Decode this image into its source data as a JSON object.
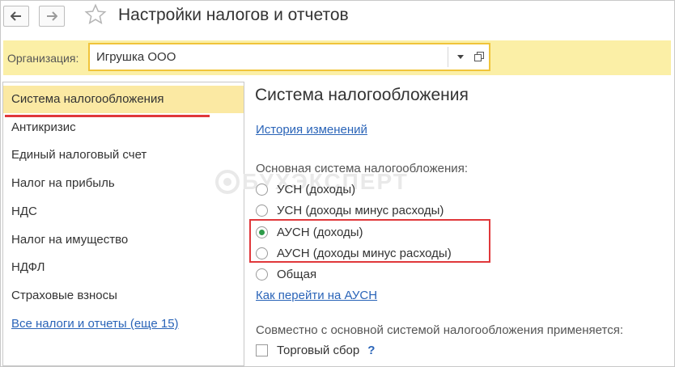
{
  "window": {
    "title": "Настройки налогов и отчетов"
  },
  "organization": {
    "label": "Организация:",
    "value": "Игрушка ООО"
  },
  "sidebar": {
    "items": [
      {
        "label": "Система налогообложения",
        "active": true
      },
      {
        "label": "Антикризис"
      },
      {
        "label": "Единый налоговый счет"
      },
      {
        "label": "Налог на прибыль"
      },
      {
        "label": "НДС"
      },
      {
        "label": "Налог на имущество"
      },
      {
        "label": "НДФЛ"
      },
      {
        "label": "Страховые взносы"
      }
    ],
    "all_link": "Все налоги и отчеты (еще 15)"
  },
  "main": {
    "title": "Система налогообложения",
    "history_link": "История изменений",
    "tax_system_label": "Основная система налогообложения:",
    "options": [
      {
        "label": "УСН (доходы)",
        "checked": false
      },
      {
        "label": "УСН (доходы минус расходы)",
        "checked": false
      },
      {
        "label": "АУСН (доходы)",
        "checked": true
      },
      {
        "label": "АУСН (доходы минус расходы)",
        "checked": false
      },
      {
        "label": "Общая",
        "checked": false
      }
    ],
    "ausn_link": "Как перейти на АУСН",
    "combined_label": "Совместно с основной системой налогообложения применяется:",
    "trade_fee_label": "Торговый сбор",
    "help_mark": "?"
  },
  "watermark": "БУХЭКСПЕРТ",
  "colors": {
    "accent_yellow": "#fbefa6",
    "active_item": "#fbe9a3",
    "highlight_red": "#e0383b",
    "link_blue": "#2a64b8",
    "radio_green": "#2e9b4a"
  }
}
